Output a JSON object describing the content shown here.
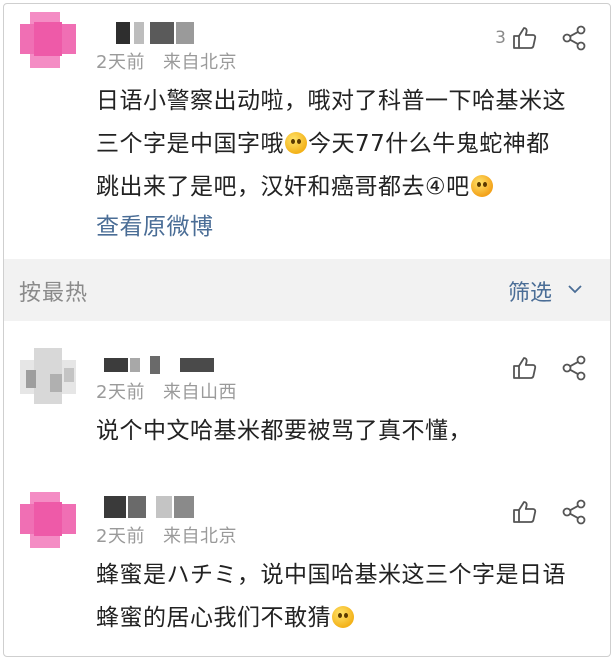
{
  "colors": {
    "link": "#4a6d96",
    "meta": "#9a9a9a",
    "avatar_pink": "#f06fb4",
    "sort_bg": "#f2f2f2"
  },
  "comments": [
    {
      "time": "2天前",
      "location": "来自北京",
      "like_count": "3",
      "text_lines": [
        [
          "日语小警察出动啦，哦对了科普一下哈基米这"
        ],
        [
          "三个字是中国字哦",
          "今天77什么牛鬼蛇神都"
        ],
        [
          "跳出来了是吧，汉奸和癌哥都去④吧",
          ""
        ]
      ],
      "view_original": "查看原微博"
    },
    {
      "time": "2天前",
      "location": "来自山西",
      "text_lines": [
        [
          "说个中文哈基米都要被骂了真不懂，"
        ]
      ]
    },
    {
      "time": "2天前",
      "location": "来自北京",
      "text_lines": [
        [
          "蜂蜜是ハチミ，说中国哈基米这三个字是日语"
        ],
        [
          "蜂蜜的居心我们不敢猜"
        ]
      ]
    }
  ],
  "sortbar": {
    "sort_label": "按最热",
    "filter_label": "筛选"
  },
  "icons": {
    "like": "thumbs-up-icon",
    "share": "share-icon",
    "filter_chevron": "chevron-down-icon"
  }
}
